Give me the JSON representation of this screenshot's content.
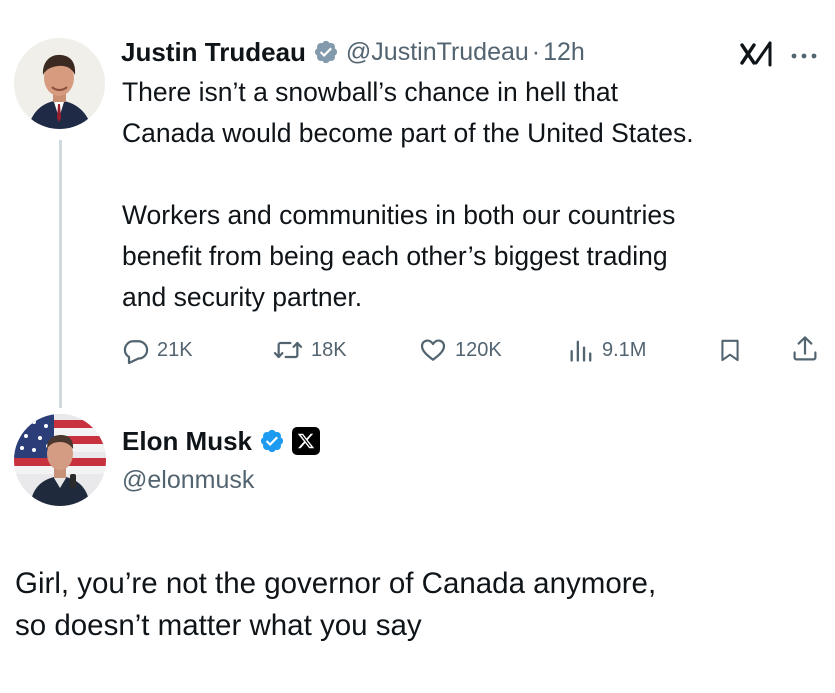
{
  "tweet": {
    "author": {
      "name": "Justin Trudeau",
      "handle": "@JustinTrudeau",
      "time": "12h"
    },
    "lines": [
      "There isn’t a snowball’s chance in hell that",
      "Canada would become part of the United States.",
      "",
      "Workers and communities in both our countries",
      "benefit from being each other’s biggest trading",
      "and security partner."
    ],
    "metrics": {
      "replies": "21K",
      "reposts": "18K",
      "likes": "120K",
      "views": "9.1M"
    },
    "icons": {
      "verified": "verified-badge-icon",
      "grok": "grok-icon",
      "more": "more-options-icon",
      "reply": "reply-icon",
      "repost": "repost-icon",
      "like": "heart-icon",
      "views": "views-icon",
      "bookmark": "bookmark-icon",
      "share": "share-icon"
    }
  },
  "reply": {
    "author": {
      "name": "Elon Musk",
      "handle": "@elonmusk"
    },
    "lines": [
      "Girl, you’re not the governor of Canada anymore,",
      "so doesn’t matter what you say"
    ]
  },
  "colors": {
    "verified_blue": "#1d9bf0",
    "verified_gray": "#829aab",
    "text_primary": "#0f1419",
    "text_secondary": "#536471"
  }
}
